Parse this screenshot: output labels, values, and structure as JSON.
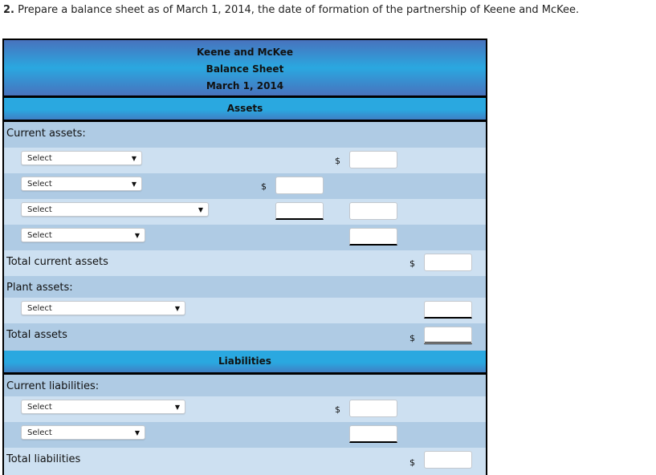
{
  "instruction": {
    "number": "2.",
    "text": "Prepare a balance sheet as of March 1, 2014, the date of formation of the partnership of Keene and McKee."
  },
  "header": {
    "company": "Keene and McKee",
    "statement": "Balance Sheet",
    "date": "March 1, 2014"
  },
  "sections": {
    "assets": "Assets",
    "liabilities": "Liabilities"
  },
  "labels": {
    "current_assets": "Current assets:",
    "total_current_assets": "Total current assets",
    "plant_assets": "Plant assets:",
    "total_assets": "Total assets",
    "current_liabilities": "Current liabilities:",
    "total_liabilities": "Total liabilities"
  },
  "currency_symbol": "$",
  "select_placeholder": "Select",
  "dropdown_arrow": "▼",
  "inputs": {
    "ca1": "",
    "ca2": "",
    "ca3a": "",
    "ca3b": "",
    "ca4": "",
    "tca": "",
    "pa1": "",
    "ta": "",
    "cl1": "",
    "cl2": "",
    "tl": ""
  }
}
